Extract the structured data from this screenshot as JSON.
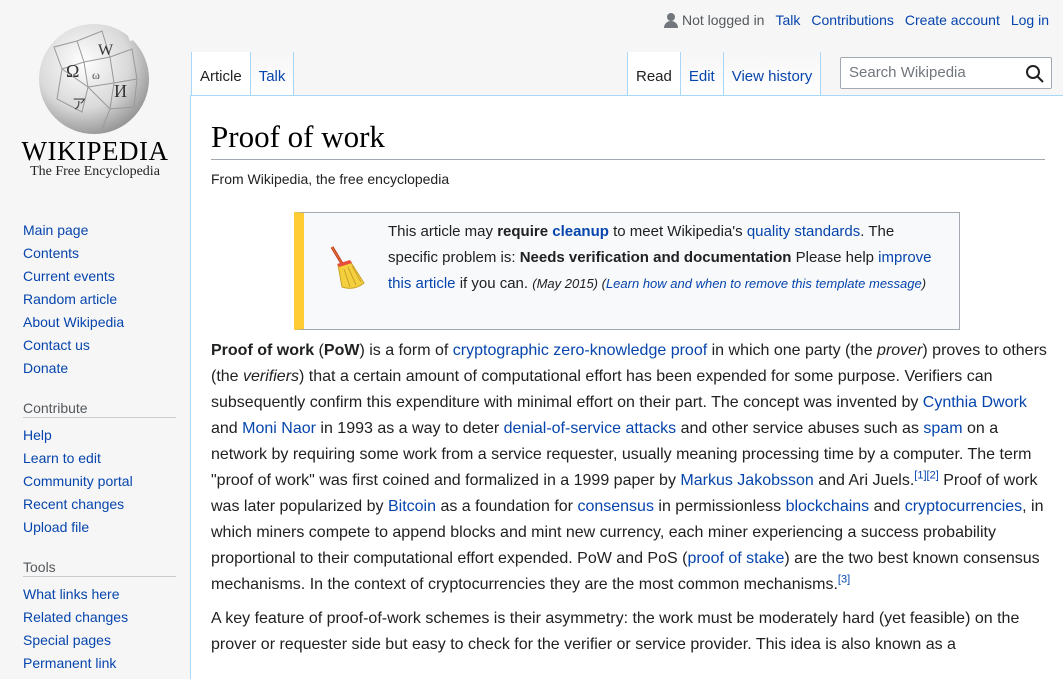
{
  "logo": {
    "wordmark": "WIKIPEDIA",
    "tagline": "The Free Encyclopedia"
  },
  "personal": {
    "not_logged_in": "Not logged in",
    "talk": "Talk",
    "contributions": "Contributions",
    "create_account": "Create account",
    "log_in": "Log in"
  },
  "tabs": {
    "article": "Article",
    "talk": "Talk",
    "read": "Read",
    "edit": "Edit",
    "view_history": "View history"
  },
  "search": {
    "placeholder": "Search Wikipedia"
  },
  "sidebar": {
    "navigation": [
      "Main page",
      "Contents",
      "Current events",
      "Random article",
      "About Wikipedia",
      "Contact us",
      "Donate"
    ],
    "contribute_heading": "Contribute",
    "contribute": [
      "Help",
      "Learn to edit",
      "Community portal",
      "Recent changes",
      "Upload file"
    ],
    "tools_heading": "Tools",
    "tools": [
      "What links here",
      "Related changes",
      "Special pages",
      "Permanent link"
    ]
  },
  "page": {
    "title": "Proof of work",
    "site_sub": "From Wikipedia, the free encyclopedia"
  },
  "ambox": {
    "t1": "This article may ",
    "require": "require",
    "cleanup": "cleanup",
    "t2": " to meet Wikipedia's ",
    "quality_standards": "quality standards",
    "t3": ". The specific problem is: ",
    "problem": "Needs verification and documentation",
    "t4": " Please help ",
    "improve_link": "improve this article",
    "t5": " if you can. ",
    "date": "(May 2015)",
    "t6": " (",
    "learn_link": "Learn how and when to remove this template message",
    "t7": ")"
  },
  "article": {
    "p1": {
      "b1": "Proof of work",
      "t1": " (",
      "b2": "PoW",
      "t2": ") is a form of ",
      "l1": "cryptographic",
      "t3": " ",
      "l2": "zero-knowledge proof",
      "t4": " in which one party (the ",
      "i1": "prover",
      "t5": ") proves to others (the ",
      "i2": "verifiers",
      "t6": ") that a certain amount of computational effort has been expended for some purpose. Verifiers can subsequently confirm this expenditure with minimal effort on their part. The concept was invented by ",
      "l3": "Cynthia Dwork",
      "t7": " and ",
      "l4": "Moni Naor",
      "t8": " in 1993 as a way to deter ",
      "l5": "denial-of-service attacks",
      "t9": " and other service abuses such as ",
      "l6": "spam",
      "t10": " on a network by requiring some work from a service requester, usually meaning processing time by a computer. The term \"proof of work\" was first coined and formalized in a 1999 paper by ",
      "l7": "Markus Jakobsson",
      "t11": " and Ari Juels.",
      "r1": "[1]",
      "r2": "[2]",
      "t12": " Proof of work was later popularized by ",
      "l8": "Bitcoin",
      "t13": " as a foundation for ",
      "l9": "consensus",
      "t14": " in permissionless ",
      "l10": "blockchains",
      "t15": " and ",
      "l11": "cryptocurrencies",
      "t16": ", in which miners compete to append blocks and mint new currency, each miner experiencing a success probability proportional to their computational effort expended. PoW and PoS (",
      "l12": "proof of stake",
      "t17": ") are the two best known consensus mechanisms. In the context of cryptocurrencies they are the most common mechanisms.",
      "r3": "[3]"
    },
    "p2": "A key feature of proof-of-work schemes is their asymmetry: the work must be moderately hard (yet feasible) on the prover or requester side but easy to check for the verifier or service provider. This idea is also known as a"
  },
  "colors": {
    "link": "#0645ad",
    "ambox_stripe": "#ffcc33",
    "border": "#a7d7f9"
  }
}
